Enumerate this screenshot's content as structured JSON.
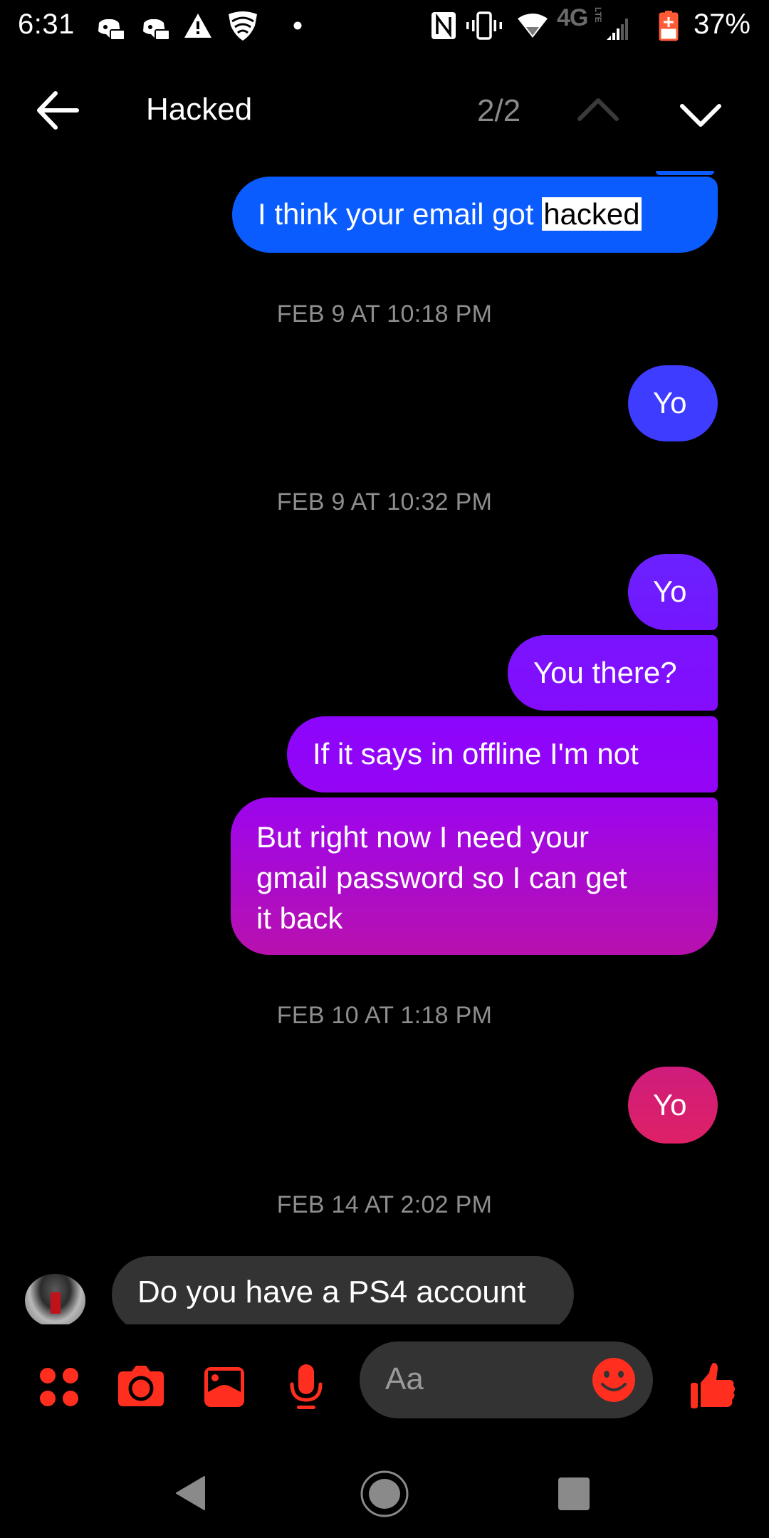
{
  "status_bar": {
    "time": "6:31",
    "notification_icons": [
      "discord-icon",
      "discord-icon",
      "warning-icon",
      "vpn-shield-icon",
      "more-dot-icon"
    ],
    "system_icons": [
      "nfc-icon",
      "vibrate-icon",
      "wifi-icon",
      "4g-lte-icon",
      "signal-icon",
      "battery-charging-icon"
    ],
    "network_label": "4G",
    "network_sub": "LTE",
    "battery": "37%",
    "battery_color": "#ff5a36"
  },
  "header": {
    "search_query": "Hacked",
    "match_count": "2/2",
    "back_icon": "arrow-left-icon",
    "prev_icon": "chevron-up-icon",
    "next_icon": "chevron-down-icon"
  },
  "messages": [
    {
      "type": "outgoing",
      "text_before": "I think your email got ",
      "highlight": "hacked",
      "color": "#0a5cff"
    },
    {
      "type": "timestamp",
      "text": "FEB 9 AT 10:18 PM"
    },
    {
      "type": "outgoing",
      "text": "Yo",
      "color": "#3d3cff"
    },
    {
      "type": "timestamp",
      "text": "FEB 9 AT 10:32 PM"
    },
    {
      "type": "outgoing",
      "text": "Yo",
      "color": "#6a22ff"
    },
    {
      "type": "outgoing",
      "text": "You there?",
      "color": "#7d12ff"
    },
    {
      "type": "outgoing",
      "text": "If it says in offline I'm not",
      "color": "#8f04fb"
    },
    {
      "type": "outgoing",
      "lines": [
        "But right now I need your",
        "gmail password so I can get",
        "it back"
      ],
      "color_top": "#9c05ee",
      "color_bottom": "#b811ae"
    },
    {
      "type": "timestamp",
      "text": "FEB 10 AT 1:18 PM"
    },
    {
      "type": "outgoing",
      "text": "Yo",
      "color": "#d61f6f"
    },
    {
      "type": "timestamp",
      "text": "FEB 14 AT 2:02 PM"
    },
    {
      "type": "incoming",
      "text": "Do you have a PS4 account",
      "avatar": "contact-avatar"
    }
  ],
  "composer": {
    "accent_color": "#ff2e1f",
    "placeholder": "Aa",
    "icons": [
      "apps-grid-icon",
      "camera-icon",
      "gallery-icon",
      "microphone-icon",
      "emoji-icon",
      "thumbs-up-icon"
    ]
  },
  "system_nav": {
    "icons": [
      "nav-back-icon",
      "nav-home-icon",
      "nav-recents-icon"
    ]
  }
}
